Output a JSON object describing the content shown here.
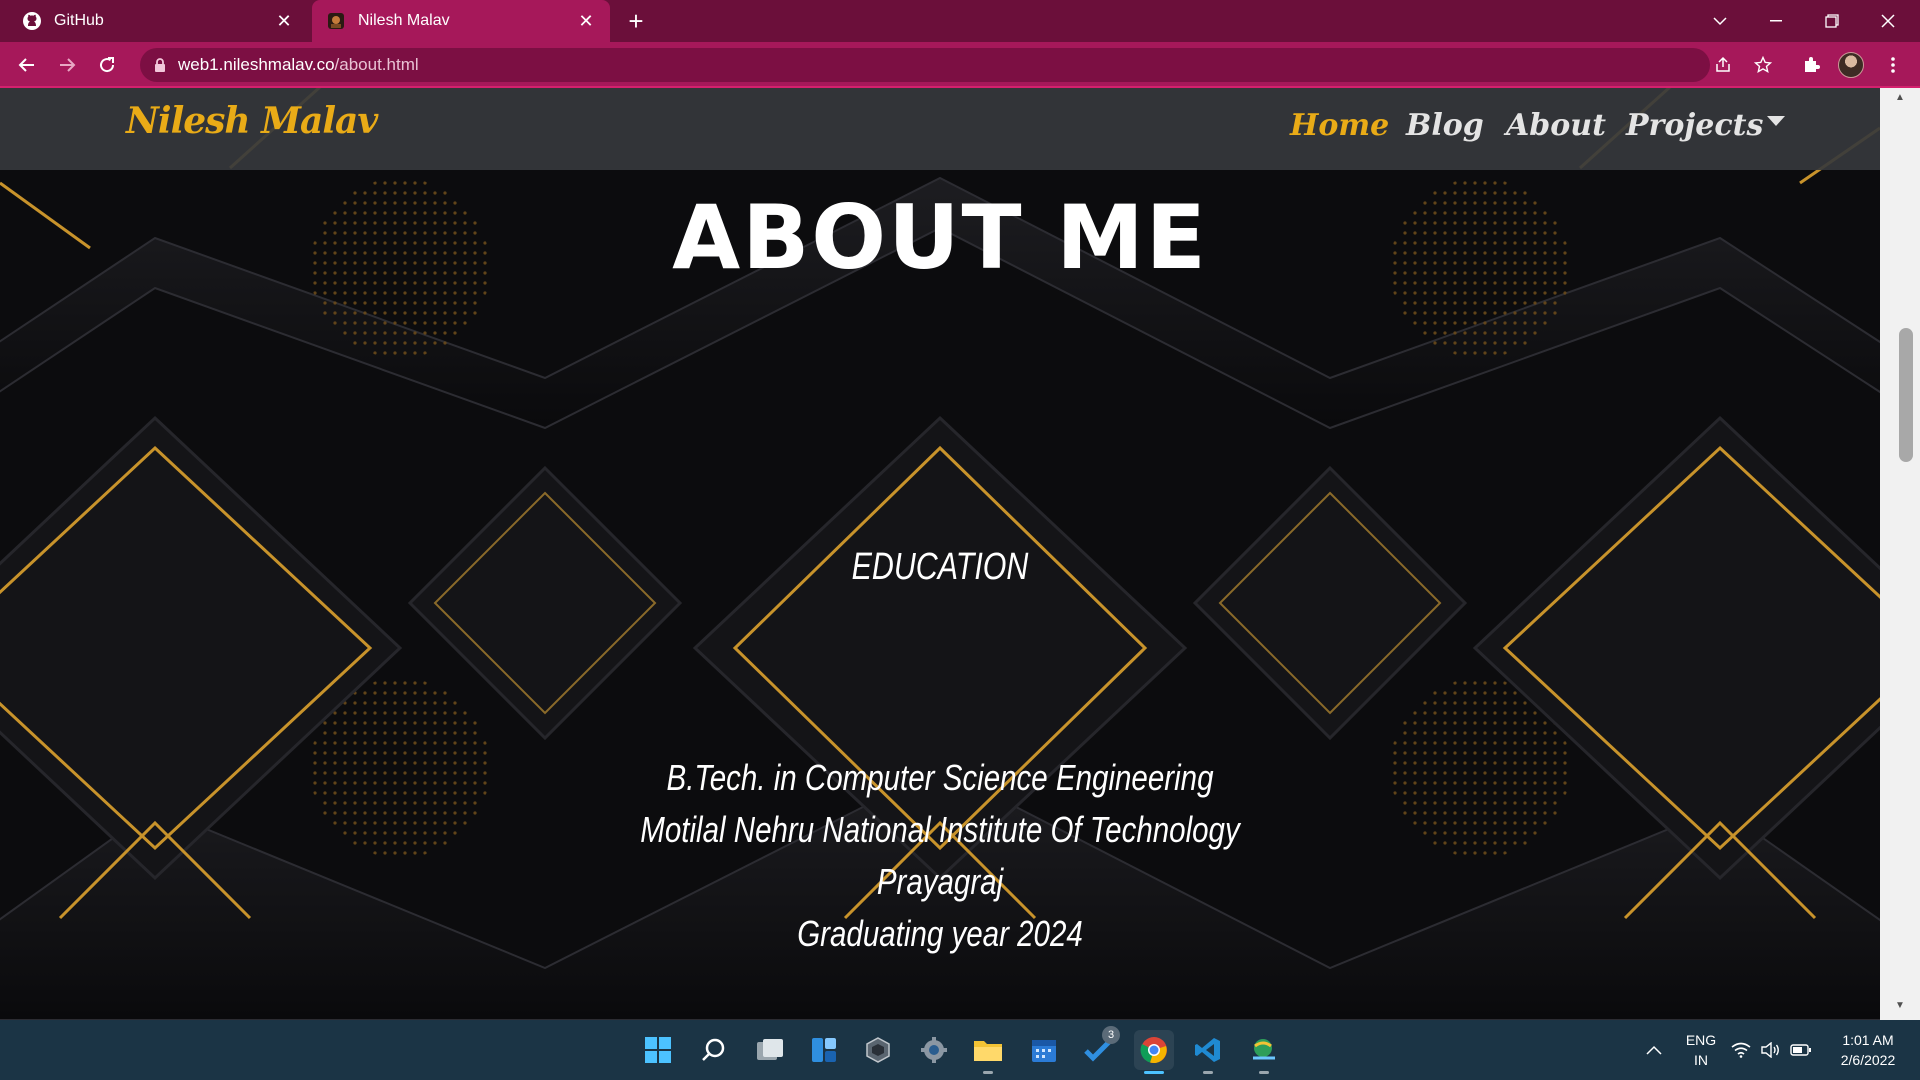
{
  "browser": {
    "tabs": [
      {
        "title": "GitHub",
        "active": false
      },
      {
        "title": "Nilesh Malav",
        "active": true
      }
    ],
    "url_host": "web1.nileshmalav.co",
    "url_path": "/about.html"
  },
  "site": {
    "brand": "Nilesh Malav",
    "nav": [
      {
        "label": "Home",
        "active": true
      },
      {
        "label": "Blog",
        "active": false
      },
      {
        "label": "About",
        "active": false
      },
      {
        "label": "Projects",
        "active": false,
        "dropdown": true
      }
    ],
    "hero_title": "ABOUT ME",
    "section_title": "EDUCATION",
    "education_lines": [
      "B.Tech. in Computer Science Engineering",
      "Motilal Nehru National Institute Of Technology",
      "Prayagraj",
      "Graduating year 2024"
    ]
  },
  "taskbar": {
    "apps": [
      "windows-start",
      "search",
      "task-view",
      "widgets",
      "app-hexagon",
      "settings",
      "file-explorer",
      "calendar",
      "todo",
      "chrome",
      "vscode",
      "app-globe"
    ],
    "todo_badge": "3",
    "language": "ENG",
    "region": "IN",
    "time": "1:01 AM",
    "date": "2/6/2022"
  },
  "colors": {
    "tabstrip": "#6b0f3a",
    "toolbar": "#a6185a",
    "accent_gold": "#e9ab17",
    "taskbar": "#1b3445"
  }
}
